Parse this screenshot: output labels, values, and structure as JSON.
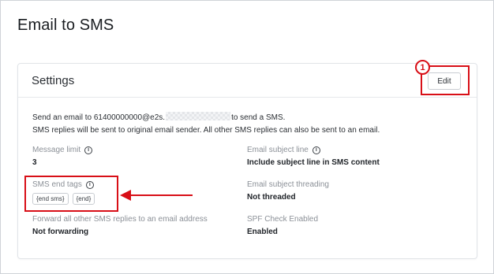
{
  "page": {
    "title": "Email to SMS"
  },
  "settings_card": {
    "title": "Settings",
    "edit_label": "Edit",
    "description": {
      "line1_prefix": "Send an email to 61400000000@e2s.",
      "line1_suffix": "to send a SMS.",
      "line2": "SMS replies will be sent to original email sender. All other SMS replies can also be sent to an email."
    },
    "fields": {
      "message_limit": {
        "label": "Message limit",
        "value": "3",
        "info_icon": "i"
      },
      "email_subject_line": {
        "label": "Email subject line",
        "value": "Include subject line in SMS content",
        "info_icon": "i"
      },
      "sms_end_tags": {
        "label": "SMS end tags",
        "info_icon": "i",
        "tags": [
          "{end sms}",
          "{end}"
        ]
      },
      "email_subject_threading": {
        "label": "Email subject threading",
        "value": "Not threaded"
      },
      "forward_replies": {
        "label": "Forward all other SMS replies to an email address",
        "value": "Not forwarding"
      },
      "spf_check": {
        "label": "SPF Check Enabled",
        "value": "Enabled"
      }
    }
  },
  "annotations": {
    "step_badge": "1",
    "accent_color": "#d80f17",
    "arrow_direction": "left"
  }
}
